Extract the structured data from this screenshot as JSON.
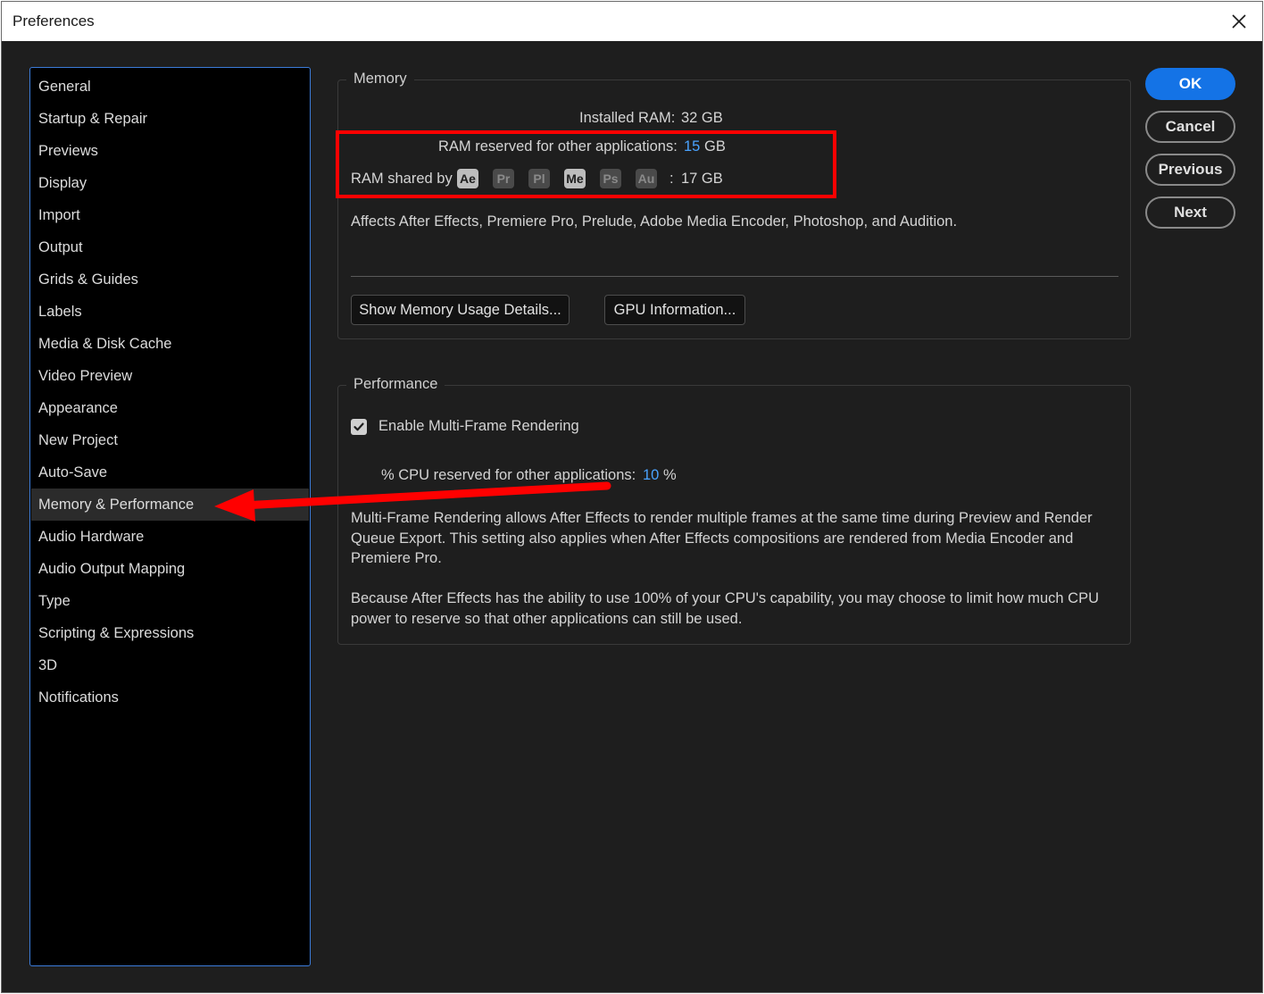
{
  "window": {
    "title": "Preferences"
  },
  "sidebar": {
    "items": [
      {
        "label": "General"
      },
      {
        "label": "Startup & Repair"
      },
      {
        "label": "Previews"
      },
      {
        "label": "Display"
      },
      {
        "label": "Import"
      },
      {
        "label": "Output"
      },
      {
        "label": "Grids & Guides"
      },
      {
        "label": "Labels"
      },
      {
        "label": "Media & Disk Cache"
      },
      {
        "label": "Video Preview"
      },
      {
        "label": "Appearance"
      },
      {
        "label": "New Project"
      },
      {
        "label": "Auto-Save"
      },
      {
        "label": "Memory & Performance"
      },
      {
        "label": "Audio Hardware"
      },
      {
        "label": "Audio Output Mapping"
      },
      {
        "label": "Type"
      },
      {
        "label": "Scripting & Expressions"
      },
      {
        "label": "3D"
      },
      {
        "label": "Notifications"
      }
    ],
    "selected": "Memory & Performance"
  },
  "memory": {
    "title": "Memory",
    "installed_label": "Installed RAM:",
    "installed_value": "32 GB",
    "reserved_label": "RAM reserved for other applications:",
    "reserved_value": "15",
    "reserved_unit": "GB",
    "shared_label": "RAM shared by",
    "apps": [
      {
        "label": "Ae",
        "active": true
      },
      {
        "label": "Pr",
        "active": false
      },
      {
        "label": "Pl",
        "active": false
      },
      {
        "label": "Me",
        "active": true
      },
      {
        "label": "Ps",
        "active": false
      },
      {
        "label": "Au",
        "active": false
      }
    ],
    "shared_colon": ":",
    "shared_value": "17 GB",
    "affects_text": "Affects After Effects, Premiere Pro, Prelude, Adobe Media Encoder, Photoshop, and Audition.",
    "show_memory_button": "Show Memory Usage Details...",
    "gpu_button": "GPU Information..."
  },
  "performance": {
    "title": "Performance",
    "mfr_label": "Enable Multi-Frame Rendering",
    "mfr_checked": true,
    "cpu_label": "% CPU reserved for other applications:",
    "cpu_value": "10",
    "cpu_unit": "%",
    "desc1_line1": "Multi-Frame Rendering allows After Effects to render multiple frames at the same time during Preview and Render",
    "desc1_line2": "Queue Export. This setting also applies when After Effects compositions are rendered from Media Encoder and",
    "desc1_line3": "Premiere Pro.",
    "desc2_line1": "Because After Effects has the ability to use 100% of your CPU's capability, you may choose to limit how much CPU",
    "desc2_line2": "power to reserve so that other applications can still be used."
  },
  "buttons": {
    "ok": "OK",
    "cancel": "Cancel",
    "previous": "Previous",
    "next": "Next"
  },
  "colors": {
    "accent": "#1473e6",
    "value_blue": "#4aa3ff",
    "annotation_red": "#ff0000",
    "sidebar_border": "#3b7bd9"
  },
  "icons": {
    "close": "close-icon",
    "check": "checkmark-icon",
    "arrow": "arrow-annotation"
  }
}
